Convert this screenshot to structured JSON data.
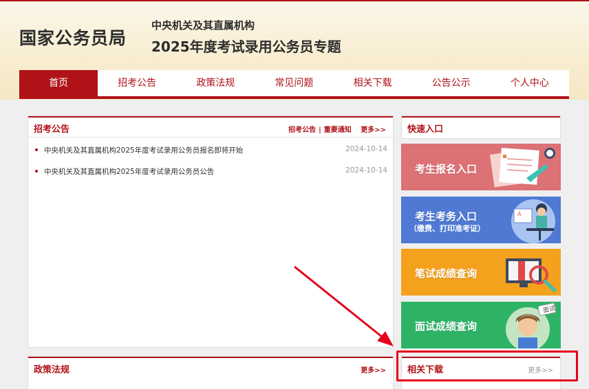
{
  "header": {
    "org_name": "国家公务员局",
    "subtitle_1": "中央机关及其直属机构",
    "subtitle_2": "2025年度考试录用公务员专题"
  },
  "nav": {
    "items": [
      "首页",
      "招考公告",
      "政策法规",
      "常见问题",
      "相关下载",
      "公告公示",
      "个人中心"
    ],
    "active": "首页"
  },
  "notices": {
    "title": "招考公告",
    "links": [
      "招考公告",
      "重要通知"
    ],
    "separator": "|",
    "more": "更多>>",
    "items": [
      {
        "text": "中央机关及其直属机构2025年度考试录用公务员报名即将开始",
        "date": "2024-10-14"
      },
      {
        "text": "中央机关及其直属机构2025年度考试录用公务员公告",
        "date": "2024-10-14"
      }
    ]
  },
  "policy": {
    "title": "政策法规",
    "more": "更多>>"
  },
  "quick": {
    "title": "快速入口",
    "entries": [
      {
        "label": "考生报名入口",
        "color": "#dc7176"
      },
      {
        "label": "考生考务入口",
        "sub": "（缴费、打印准考证）",
        "color": "#4f79d3"
      },
      {
        "label": "笔试成绩查询",
        "color": "#f4a11e"
      },
      {
        "label": "面试成绩查询",
        "color": "#2eb366",
        "badge": "面试"
      }
    ]
  },
  "downloads": {
    "title": "相关下载",
    "more": "更多>>"
  },
  "colors": {
    "brand_red": "#b01218",
    "highlight": "#e4001b"
  }
}
